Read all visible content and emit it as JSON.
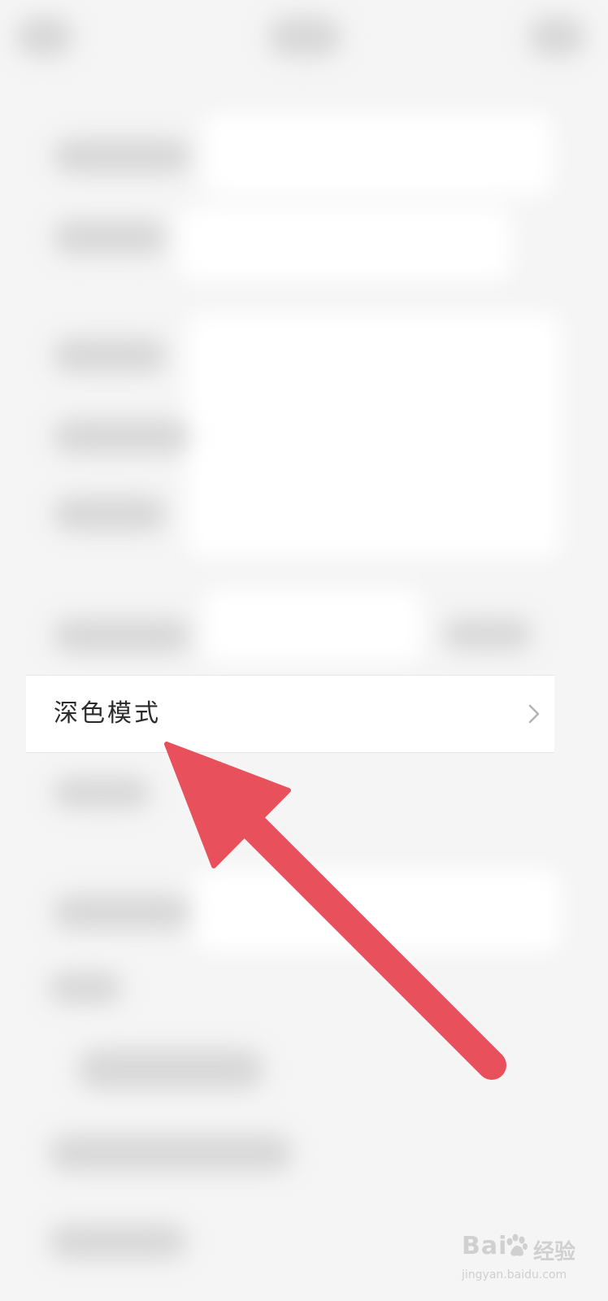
{
  "settings": {
    "focused_item": {
      "label": "深色模式",
      "chevron_icon": "chevron-right-icon"
    }
  },
  "annotation": {
    "arrow_color": "#e8505b",
    "points_to": "focused-item"
  },
  "watermark": {
    "brand": "Bai",
    "brand_suffix": "经验",
    "paw_icon": "baidu-paw-icon",
    "domain": "jingyan.baidu.com"
  }
}
